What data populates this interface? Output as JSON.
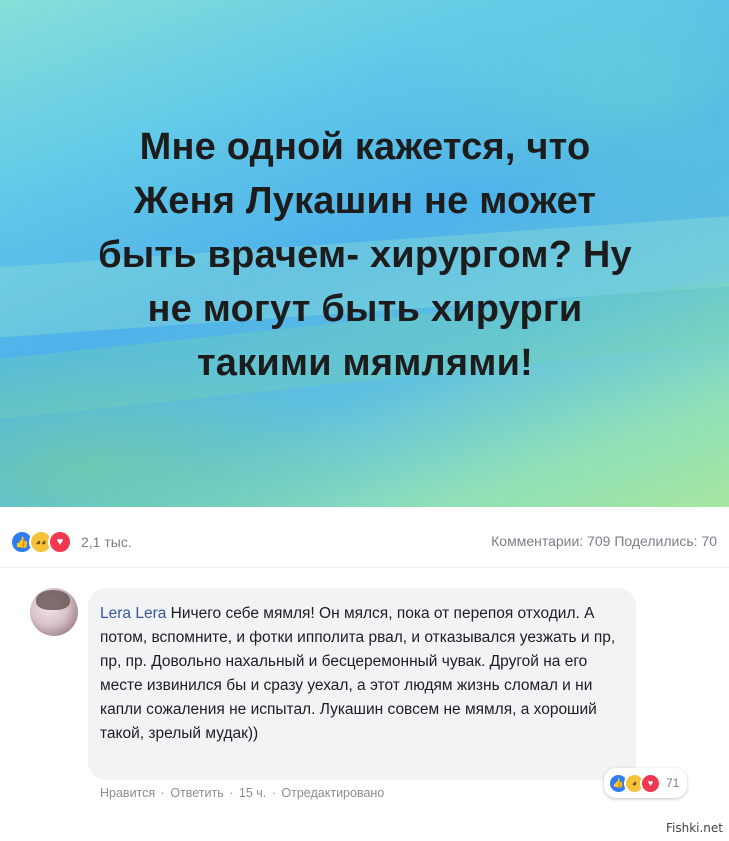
{
  "post": {
    "text": "Мне одной кажется, что\nЖеня Лукашин не может\nбыть врачем- хирургом? Ну\nне могут быть хирурги\nтакими мямлями!"
  },
  "stats": {
    "reaction_icons": [
      "like-icon",
      "haha-icon",
      "love-icon"
    ],
    "reaction_count": "2,1 тыс.",
    "comments_shares": "Комментарии: 709  Поделились: 70"
  },
  "comment": {
    "author": "Lera Lera",
    "text": "Ничего себе мямля! Он мялся, пока от перепоя отходил. А потом, вспомните, и фотки ипполита рвал, и отказывался уезжать и пр, пр, пр. Довольно нахальный и бесцеремонный чувак. Другой на его месте извинился бы и сразу уехал, а этот людям жизнь сломал и ни капли сожаления не испытал. Лукашин совсем не мямля, а хороший такой, зрелый мудак))",
    "actions": {
      "like": "Нравится",
      "reply": "Ответить",
      "time": "15 ч.",
      "edited": "Отредактировано"
    },
    "reaction_count": "71"
  },
  "watermark": "Fishki.net",
  "colors": {
    "link": "#385898",
    "like": "#2d7df6",
    "love": "#f0384f",
    "haha": "#f5c33b"
  }
}
